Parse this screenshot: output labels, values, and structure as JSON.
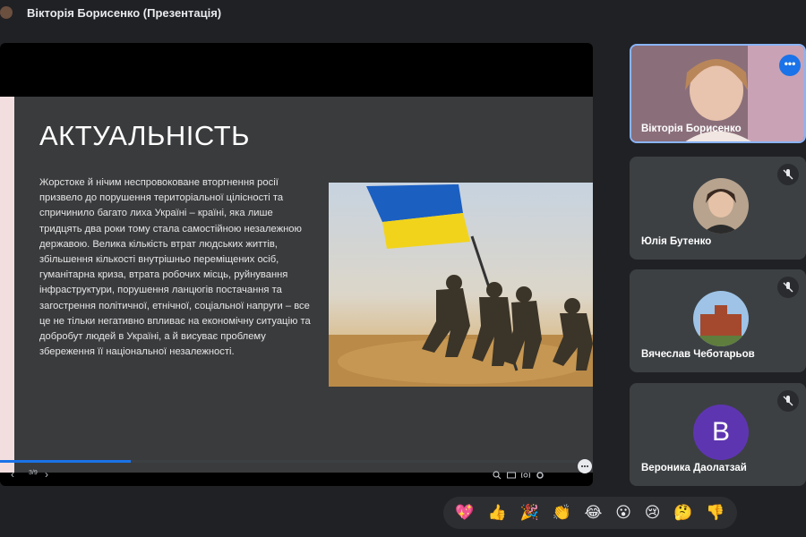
{
  "window": {
    "title": "Вікторія Борисенко (Презентація)"
  },
  "slide": {
    "heading": "АКТУАЛЬНІСТЬ",
    "body": "Жорстоке й нічим неспровоковане вторгнення росії призвело до порушення територіальної цілісності та спричинило багато лиха Україні – країні, яка лише тридцять два роки тому стала самостійною незалежною державою. Велика кількість втрат людських життів, збільшення кількості внутрішньо переміщених осіб, гуманітарна криза, втрата робочих місць, руйнування інфраструктури, порушення ланцюгів постачання та загострення політичної, етнічної, соціальної напруги – все це не тільки негативно впливає на економічну ситуацію та добробут людей в Україні, а й висуває проблему збереження її національної незалежності.",
    "counter": "3/9",
    "progress": 0.22
  },
  "colors": {
    "accent": "#1a73e8",
    "active_border": "#8ab4f8",
    "flag_blue": "#0057b7",
    "flag_yellow": "#ffd700"
  },
  "participants": [
    {
      "name": "Вікторія Борисенко",
      "type": "video"
    },
    {
      "name": "Юлія Бутенко",
      "type": "photo-avatar",
      "muted": true
    },
    {
      "name": "Вячеслав Чеботарьов",
      "type": "photo-avatar",
      "muted": true
    },
    {
      "name": "Вероника Даолатзай",
      "type": "letter-avatar",
      "letter": "В",
      "muted": true
    }
  ],
  "reactions": [
    "💖",
    "👍",
    "🎉",
    "👏",
    "😂",
    "😮",
    "😢",
    "🤔",
    "👎"
  ],
  "icons": [
    "chevron-left-icon",
    "chevron-right-icon",
    "zoom-icon",
    "captions-icon",
    "cast-icon",
    "settings-icon",
    "chat-icon",
    "mic-off-icon",
    "more-options-icon"
  ]
}
